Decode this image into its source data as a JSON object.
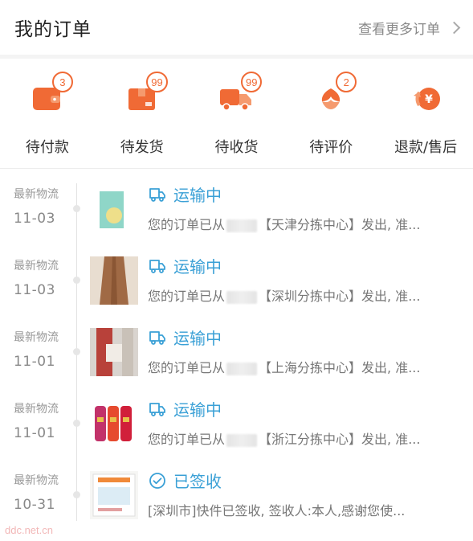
{
  "header": {
    "title": "我的订单",
    "more_label": "查看更多订单"
  },
  "status_items": [
    {
      "label": "待付款",
      "badge": "3",
      "icon": "wallet-icon"
    },
    {
      "label": "待发货",
      "badge": "99",
      "icon": "package-icon"
    },
    {
      "label": "待收货",
      "badge": "99",
      "icon": "truck-icon"
    },
    {
      "label": "待评价",
      "badge": "2",
      "icon": "flower-icon"
    },
    {
      "label": "退款/售后",
      "badge": "",
      "icon": "refund-yen-icon"
    }
  ],
  "orders": [
    {
      "label": "最新物流",
      "date": "11-03",
      "status": "运输中",
      "desc_prefix": "您的订单已从",
      "desc_suffix": "【天津分拣中心】发出, 准...",
      "icon": "truck-outline-icon"
    },
    {
      "label": "最新物流",
      "date": "11-03",
      "status": "运输中",
      "desc_prefix": "您的订单已从",
      "desc_suffix": "【深圳分拣中心】发出, 准...",
      "icon": "truck-outline-icon"
    },
    {
      "label": "最新物流",
      "date": "11-01",
      "status": "运输中",
      "desc_prefix": "您的订单已从",
      "desc_suffix": "【上海分拣中心】发出, 准...",
      "icon": "truck-outline-icon"
    },
    {
      "label": "最新物流",
      "date": "11-01",
      "status": "运输中",
      "desc_prefix": "您的订单已从",
      "desc_suffix": "【浙江分拣中心】发出, 准...",
      "icon": "truck-outline-icon"
    },
    {
      "label": "最新物流",
      "date": "10-31",
      "status": "已签收",
      "desc_prefix": "",
      "desc_suffix": "[深圳市]快件已签收, 签收人:本人,感谢您使...",
      "icon": "check-circle-icon"
    }
  ],
  "watermark": "ddc.net.cn",
  "colors": {
    "accent_orange": "#f06a35",
    "status_blue": "#3aa0d6"
  }
}
